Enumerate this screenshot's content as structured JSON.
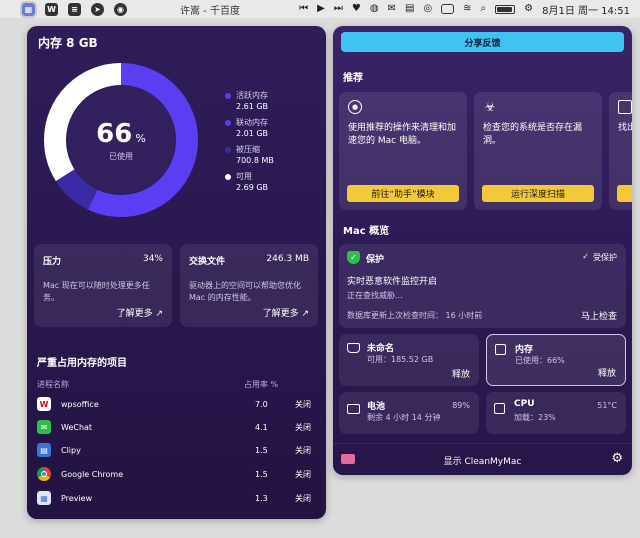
{
  "menubar": {
    "window_title": "许嵩 - 千百度",
    "left_icons": [
      "cleanmymac-icon",
      "wps-icon",
      "clipboard-icon",
      "navigation-icon",
      "compass-icon"
    ],
    "date_time": "8月1日 周一  14:51"
  },
  "left_panel": {
    "title": "内存 8 GB",
    "donut": {
      "percent": "66",
      "percent_sign": "%",
      "sub": "已使用",
      "used_fraction": 0.66
    },
    "legend": [
      {
        "label": "活跃内存",
        "value": "2.61 GB",
        "color": "#5b3df2"
      },
      {
        "label": "联动内存",
        "value": "2.01 GB",
        "color": "#5b3df2"
      },
      {
        "label": "被压缩",
        "value": "700.8 MB",
        "color": "#3b2aa6"
      },
      {
        "label": "可用",
        "value": "2.69 GB",
        "color": "#ffffff"
      }
    ],
    "pressure": {
      "title": "压力",
      "value": "34%",
      "desc": "Mac 现在可以随时处理更多任务。",
      "link": "了解更多 ↗"
    },
    "swap": {
      "title": "交换文件",
      "value": "246.3 MB",
      "desc": "驱动器上的空间可以帮助您优化 Mac 的内存性能。",
      "link": "了解更多 ↗"
    },
    "heavy_title": "严重占用内存的项目",
    "table_head": {
      "name": "进程名称",
      "usage": "占用率 %"
    },
    "processes": [
      {
        "name": "wpsoffice",
        "usage": "7.0",
        "action": "关闭",
        "icon_color": "#ffffff",
        "icon_fg": "#d0021b",
        "glyph": "W"
      },
      {
        "name": "WeChat",
        "usage": "4.1",
        "action": "关闭",
        "icon_color": "#2bc04a",
        "icon_fg": "#ffffff",
        "glyph": "W"
      },
      {
        "name": "Clipy",
        "usage": "1.5",
        "action": "关闭",
        "icon_color": "#3a78d6",
        "icon_fg": "#ffffff",
        "glyph": "C"
      },
      {
        "name": "Google Chrome",
        "usage": "1.5",
        "action": "关闭",
        "icon_color": "#ffffff",
        "icon_fg": "#4285f4",
        "glyph": "G"
      },
      {
        "name": "Preview",
        "usage": "1.3",
        "action": "关闭",
        "icon_color": "#dfe6f2",
        "icon_fg": "#3a78d6",
        "glyph": "P"
      }
    ]
  },
  "right_panel": {
    "share_button": "分享反馈",
    "recommend_title": "推荐",
    "rec_cards": [
      {
        "text": "使用推荐的操作来清理和加速您的 Mac 电脑。",
        "button": "前往“助手”模块"
      },
      {
        "text": "检查您的系统是否存在漏洞。",
        "button": "运行深度扫描"
      },
      {
        "text": "找出"
      }
    ],
    "overview_title": "Mac 概览",
    "protection": {
      "title": "保护",
      "status": "受保护",
      "headline": "实时恶意软件监控开启",
      "sub": "正在查找威胁...",
      "db_update": "数据库更新上次检查时间： 16 小时前",
      "action": "马上检查"
    },
    "disk": {
      "title": "未命名",
      "sub": "可用：185.52 GB",
      "action": "释放"
    },
    "memory": {
      "title": "内存",
      "sub": "已使用：66%",
      "action": "释放"
    },
    "battery": {
      "title": "电池",
      "right": "89%",
      "sub": "剩余 4 小时 14 分钟"
    },
    "cpu": {
      "title": "CPU",
      "right": "51°C",
      "sub": "加载：23%"
    },
    "footer_label": "显示 CleanMyMac"
  }
}
